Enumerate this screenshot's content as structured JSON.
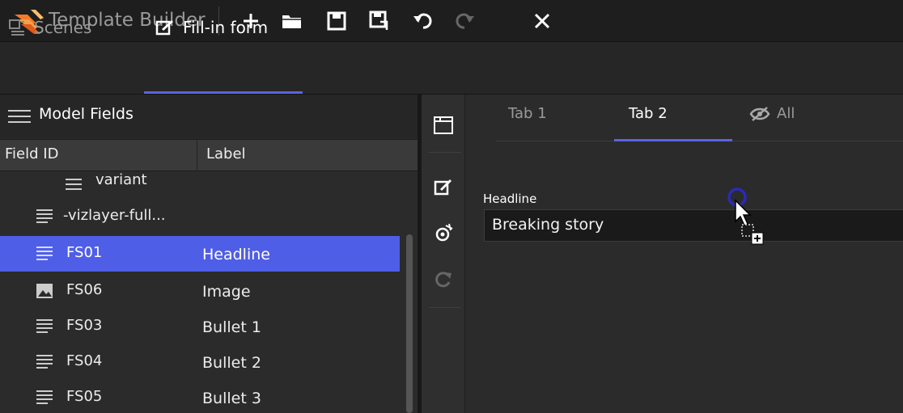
{
  "app": {
    "title": "Template Builder",
    "logo_icon": "vizrt-logo-icon",
    "accent": "#4f5ee6",
    "logo_color": "#f07c2a"
  },
  "toolbar": {
    "icons": [
      "add-icon",
      "open-folder-icon",
      "save-icon",
      "save-as-icon",
      "undo-icon",
      "redo-icon",
      "close-icon"
    ]
  },
  "main_tabs": {
    "scenes": "Scenes",
    "fill_in_form": "Fill-in form",
    "active": "Fill-in form"
  },
  "model_fields": {
    "title": "Model Fields",
    "columns": {
      "field_id": "Field ID",
      "label": "Label"
    },
    "rows": [
      {
        "field_id": "variant",
        "label": "",
        "icon": "text-lines-icon",
        "indent": "nested"
      },
      {
        "field_id": "-vizlayer-full...",
        "label": "",
        "icon": "text-lines-icon",
        "indent": "child"
      },
      {
        "field_id": "FS01",
        "label": "Headline",
        "icon": "text-lines-icon",
        "selected": true
      },
      {
        "field_id": "FS06",
        "label": "Image",
        "icon": "image-icon"
      },
      {
        "field_id": "FS03",
        "label": "Bullet 1",
        "icon": "text-lines-icon"
      },
      {
        "field_id": "FS04",
        "label": "Bullet 2",
        "icon": "text-lines-icon"
      },
      {
        "field_id": "FS05",
        "label": "Bullet 3",
        "icon": "text-lines-icon"
      }
    ]
  },
  "side_tools": [
    "new-tab-icon",
    "edit-form-icon",
    "visibility-icon",
    "refresh-icon"
  ],
  "form_tabs": {
    "tab1": "Tab 1",
    "tab2": "Tab 2",
    "all": "All",
    "active": "Tab 2"
  },
  "form": {
    "headline_label": "Headline",
    "headline_value": "Breaking story"
  }
}
